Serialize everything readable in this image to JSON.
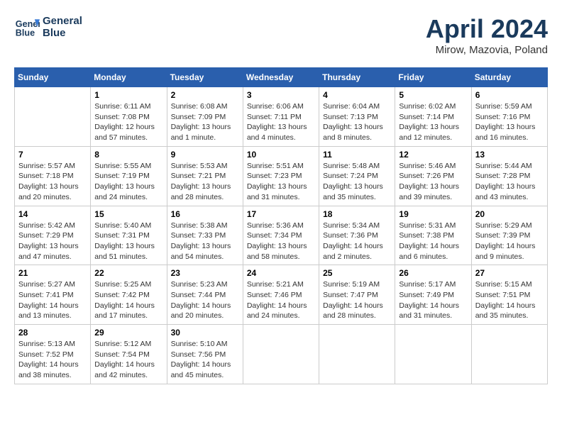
{
  "header": {
    "logo_line1": "General",
    "logo_line2": "Blue",
    "month_title": "April 2024",
    "location": "Mirow, Mazovia, Poland"
  },
  "weekdays": [
    "Sunday",
    "Monday",
    "Tuesday",
    "Wednesday",
    "Thursday",
    "Friday",
    "Saturday"
  ],
  "weeks": [
    [
      {
        "day": "",
        "sunrise": "",
        "sunset": "",
        "daylight": ""
      },
      {
        "day": "1",
        "sunrise": "Sunrise: 6:11 AM",
        "sunset": "Sunset: 7:08 PM",
        "daylight": "Daylight: 12 hours and 57 minutes."
      },
      {
        "day": "2",
        "sunrise": "Sunrise: 6:08 AM",
        "sunset": "Sunset: 7:09 PM",
        "daylight": "Daylight: 13 hours and 1 minute."
      },
      {
        "day": "3",
        "sunrise": "Sunrise: 6:06 AM",
        "sunset": "Sunset: 7:11 PM",
        "daylight": "Daylight: 13 hours and 4 minutes."
      },
      {
        "day": "4",
        "sunrise": "Sunrise: 6:04 AM",
        "sunset": "Sunset: 7:13 PM",
        "daylight": "Daylight: 13 hours and 8 minutes."
      },
      {
        "day": "5",
        "sunrise": "Sunrise: 6:02 AM",
        "sunset": "Sunset: 7:14 PM",
        "daylight": "Daylight: 13 hours and 12 minutes."
      },
      {
        "day": "6",
        "sunrise": "Sunrise: 5:59 AM",
        "sunset": "Sunset: 7:16 PM",
        "daylight": "Daylight: 13 hours and 16 minutes."
      }
    ],
    [
      {
        "day": "7",
        "sunrise": "Sunrise: 5:57 AM",
        "sunset": "Sunset: 7:18 PM",
        "daylight": "Daylight: 13 hours and 20 minutes."
      },
      {
        "day": "8",
        "sunrise": "Sunrise: 5:55 AM",
        "sunset": "Sunset: 7:19 PM",
        "daylight": "Daylight: 13 hours and 24 minutes."
      },
      {
        "day": "9",
        "sunrise": "Sunrise: 5:53 AM",
        "sunset": "Sunset: 7:21 PM",
        "daylight": "Daylight: 13 hours and 28 minutes."
      },
      {
        "day": "10",
        "sunrise": "Sunrise: 5:51 AM",
        "sunset": "Sunset: 7:23 PM",
        "daylight": "Daylight: 13 hours and 31 minutes."
      },
      {
        "day": "11",
        "sunrise": "Sunrise: 5:48 AM",
        "sunset": "Sunset: 7:24 PM",
        "daylight": "Daylight: 13 hours and 35 minutes."
      },
      {
        "day": "12",
        "sunrise": "Sunrise: 5:46 AM",
        "sunset": "Sunset: 7:26 PM",
        "daylight": "Daylight: 13 hours and 39 minutes."
      },
      {
        "day": "13",
        "sunrise": "Sunrise: 5:44 AM",
        "sunset": "Sunset: 7:28 PM",
        "daylight": "Daylight: 13 hours and 43 minutes."
      }
    ],
    [
      {
        "day": "14",
        "sunrise": "Sunrise: 5:42 AM",
        "sunset": "Sunset: 7:29 PM",
        "daylight": "Daylight: 13 hours and 47 minutes."
      },
      {
        "day": "15",
        "sunrise": "Sunrise: 5:40 AM",
        "sunset": "Sunset: 7:31 PM",
        "daylight": "Daylight: 13 hours and 51 minutes."
      },
      {
        "day": "16",
        "sunrise": "Sunrise: 5:38 AM",
        "sunset": "Sunset: 7:33 PM",
        "daylight": "Daylight: 13 hours and 54 minutes."
      },
      {
        "day": "17",
        "sunrise": "Sunrise: 5:36 AM",
        "sunset": "Sunset: 7:34 PM",
        "daylight": "Daylight: 13 hours and 58 minutes."
      },
      {
        "day": "18",
        "sunrise": "Sunrise: 5:34 AM",
        "sunset": "Sunset: 7:36 PM",
        "daylight": "Daylight: 14 hours and 2 minutes."
      },
      {
        "day": "19",
        "sunrise": "Sunrise: 5:31 AM",
        "sunset": "Sunset: 7:38 PM",
        "daylight": "Daylight: 14 hours and 6 minutes."
      },
      {
        "day": "20",
        "sunrise": "Sunrise: 5:29 AM",
        "sunset": "Sunset: 7:39 PM",
        "daylight": "Daylight: 14 hours and 9 minutes."
      }
    ],
    [
      {
        "day": "21",
        "sunrise": "Sunrise: 5:27 AM",
        "sunset": "Sunset: 7:41 PM",
        "daylight": "Daylight: 14 hours and 13 minutes."
      },
      {
        "day": "22",
        "sunrise": "Sunrise: 5:25 AM",
        "sunset": "Sunset: 7:42 PM",
        "daylight": "Daylight: 14 hours and 17 minutes."
      },
      {
        "day": "23",
        "sunrise": "Sunrise: 5:23 AM",
        "sunset": "Sunset: 7:44 PM",
        "daylight": "Daylight: 14 hours and 20 minutes."
      },
      {
        "day": "24",
        "sunrise": "Sunrise: 5:21 AM",
        "sunset": "Sunset: 7:46 PM",
        "daylight": "Daylight: 14 hours and 24 minutes."
      },
      {
        "day": "25",
        "sunrise": "Sunrise: 5:19 AM",
        "sunset": "Sunset: 7:47 PM",
        "daylight": "Daylight: 14 hours and 28 minutes."
      },
      {
        "day": "26",
        "sunrise": "Sunrise: 5:17 AM",
        "sunset": "Sunset: 7:49 PM",
        "daylight": "Daylight: 14 hours and 31 minutes."
      },
      {
        "day": "27",
        "sunrise": "Sunrise: 5:15 AM",
        "sunset": "Sunset: 7:51 PM",
        "daylight": "Daylight: 14 hours and 35 minutes."
      }
    ],
    [
      {
        "day": "28",
        "sunrise": "Sunrise: 5:13 AM",
        "sunset": "Sunset: 7:52 PM",
        "daylight": "Daylight: 14 hours and 38 minutes."
      },
      {
        "day": "29",
        "sunrise": "Sunrise: 5:12 AM",
        "sunset": "Sunset: 7:54 PM",
        "daylight": "Daylight: 14 hours and 42 minutes."
      },
      {
        "day": "30",
        "sunrise": "Sunrise: 5:10 AM",
        "sunset": "Sunset: 7:56 PM",
        "daylight": "Daylight: 14 hours and 45 minutes."
      },
      {
        "day": "",
        "sunrise": "",
        "sunset": "",
        "daylight": ""
      },
      {
        "day": "",
        "sunrise": "",
        "sunset": "",
        "daylight": ""
      },
      {
        "day": "",
        "sunrise": "",
        "sunset": "",
        "daylight": ""
      },
      {
        "day": "",
        "sunrise": "",
        "sunset": "",
        "daylight": ""
      }
    ]
  ]
}
